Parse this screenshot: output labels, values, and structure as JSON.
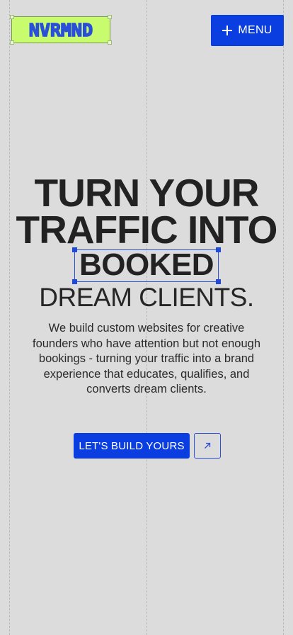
{
  "header": {
    "logo_text": "NVRMND",
    "menu_label": "MENU"
  },
  "hero": {
    "headline_line1": "TURN YOUR",
    "headline_line2": "TRAFFIC INTO",
    "headline_highlight": "BOOKED",
    "headline_line4": "DREAM CLIENTS.",
    "description": "We build custom websites for creative founders who have attention but not enough bookings - turning your traffic into a brand experience that educates, qualifies, and converts dream clients."
  },
  "cta": {
    "primary_label": "LET'S BUILD YOURS"
  },
  "icons": {
    "menu": "plus-icon",
    "cta_secondary": "arrow-up-right-icon"
  },
  "colors": {
    "background": "#dcdcdc",
    "accent_blue": "#0a3ee0",
    "logo_green": "#c8fb6d",
    "text_dark": "#222222"
  }
}
